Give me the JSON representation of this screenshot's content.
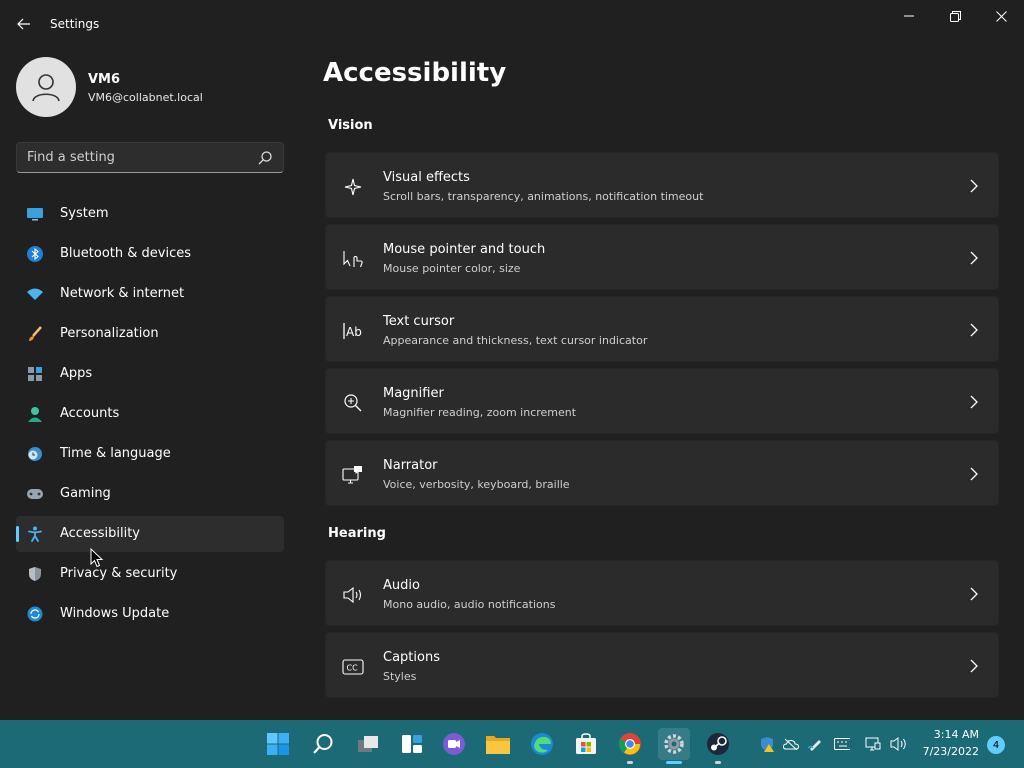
{
  "window": {
    "title": "Settings"
  },
  "profile": {
    "name": "VM6",
    "email": "VM6@collabnet.local"
  },
  "search": {
    "placeholder": "Find a setting"
  },
  "nav": {
    "items": [
      {
        "label": "System",
        "icon": "monitor-icon"
      },
      {
        "label": "Bluetooth & devices",
        "icon": "bluetooth-icon"
      },
      {
        "label": "Network & internet",
        "icon": "wifi-icon"
      },
      {
        "label": "Personalization",
        "icon": "brush-icon"
      },
      {
        "label": "Apps",
        "icon": "apps-icon"
      },
      {
        "label": "Accounts",
        "icon": "account-icon"
      },
      {
        "label": "Time & language",
        "icon": "clock-globe-icon"
      },
      {
        "label": "Gaming",
        "icon": "gamepad-icon"
      },
      {
        "label": "Accessibility",
        "icon": "accessibility-icon",
        "selected": true
      },
      {
        "label": "Privacy & security",
        "icon": "shield-icon"
      },
      {
        "label": "Windows Update",
        "icon": "update-icon"
      }
    ]
  },
  "main": {
    "title": "Accessibility",
    "sections": [
      {
        "label": "Vision",
        "cards": [
          {
            "title": "Visual effects",
            "subtitle": "Scroll bars, transparency, animations, notification timeout",
            "icon": "sparkle-icon"
          },
          {
            "title": "Mouse pointer and touch",
            "subtitle": "Mouse pointer color, size",
            "icon": "pointer-touch-icon"
          },
          {
            "title": "Text cursor",
            "subtitle": "Appearance and thickness, text cursor indicator",
            "icon": "text-cursor-icon"
          },
          {
            "title": "Magnifier",
            "subtitle": "Magnifier reading, zoom increment",
            "icon": "magnifier-icon"
          },
          {
            "title": "Narrator",
            "subtitle": "Voice, verbosity, keyboard, braille",
            "icon": "narrator-icon"
          }
        ]
      },
      {
        "label": "Hearing",
        "cards": [
          {
            "title": "Audio",
            "subtitle": "Mono audio, audio notifications",
            "icon": "speaker-icon"
          },
          {
            "title": "Captions",
            "subtitle": "Styles",
            "icon": "captions-icon"
          }
        ]
      }
    ]
  },
  "taskbar": {
    "apps": [
      "start-icon",
      "search-icon",
      "task-view-icon",
      "widgets-icon",
      "teams-chat-icon",
      "file-explorer-icon",
      "edge-icon",
      "store-icon",
      "chrome-icon",
      "settings-icon",
      "steam-icon"
    ],
    "clock": {
      "time": "3:14 AM",
      "date": "7/23/2022"
    },
    "notifications": {
      "count": "4"
    }
  },
  "colors": {
    "accent": "#60cdff",
    "taskbar": "#1b6a76",
    "background": "#202020",
    "card": "#2b2b2b"
  }
}
